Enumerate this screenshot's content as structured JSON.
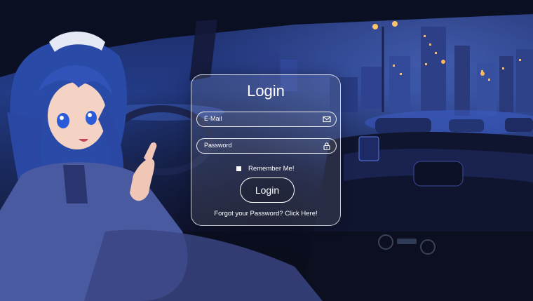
{
  "login": {
    "title": "Login",
    "email_label": "E-Mail",
    "email_icon": "envelope-icon",
    "password_label": "Password",
    "password_icon": "lock-icon",
    "remember_label": "Remember Me!",
    "button_label": "Login",
    "forgot_label": "Forgot your Password? Click Here!"
  },
  "background": {
    "scene": "anime girl in car at night with city skyline"
  },
  "colors": {
    "text": "#ffffff",
    "card_border": "#ffffff"
  }
}
